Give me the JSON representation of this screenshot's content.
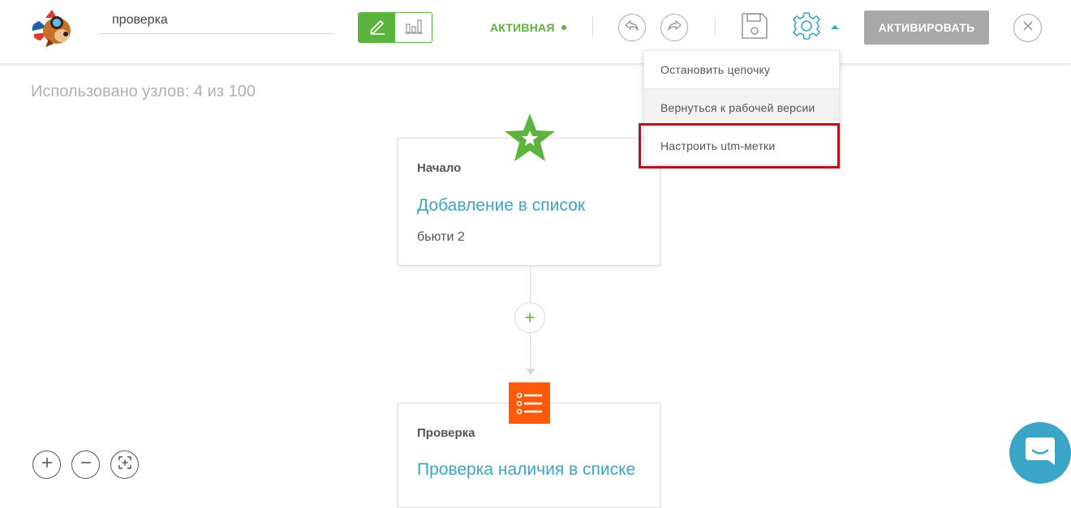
{
  "header": {
    "chain_name": "проверка",
    "status_label": "АКТИВНАЯ",
    "activate_label": "АКТИВИРОВАТЬ"
  },
  "settings_menu": {
    "items": [
      {
        "label": "Остановить цепочку"
      },
      {
        "label": "Вернуться к рабочей версии"
      },
      {
        "label": "Настроить utm-метки"
      }
    ]
  },
  "canvas": {
    "usage": "Использовано узлов: 4 из 100",
    "nodes": [
      {
        "type": "Начало",
        "title": "Добавление в список",
        "subtitle": "бьюти 2"
      },
      {
        "type": "Проверка",
        "title": "Проверка наличия в списке",
        "subtitle": ""
      }
    ],
    "add_symbol": "+"
  },
  "colors": {
    "accent_green": "#5cb43e",
    "link_blue": "#3aa5c7",
    "start_star": "#5cb43e",
    "check_icon": "#ff5a0a",
    "highlight_red": "#b5121b",
    "disabled_gray": "#a8a8a8"
  },
  "icons": [
    "logo",
    "pencil-icon",
    "chart-icon",
    "undo-icon",
    "redo-icon",
    "save-icon",
    "gear-icon",
    "caret-up-icon",
    "close-icon",
    "star-icon",
    "list-icon",
    "zoom-in-icon",
    "zoom-out-icon",
    "fit-icon",
    "chat-icon"
  ]
}
